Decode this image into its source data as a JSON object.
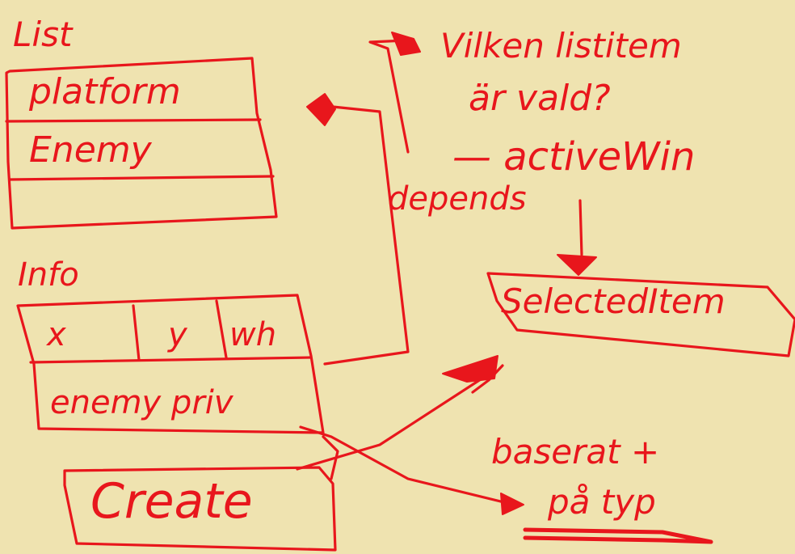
{
  "list": {
    "title": "List",
    "items": [
      "platform",
      "Enemy",
      ""
    ]
  },
  "info": {
    "title": "Info",
    "columns": [
      "x",
      "y",
      "wh"
    ],
    "detail": "enemy priv"
  },
  "create_label": "Create",
  "note": {
    "question_line1": "Vilken listitem",
    "question_line2": "är vald?",
    "active": "— activeWin",
    "depends": "depends"
  },
  "selected_item": "SelectedItem",
  "based_on": {
    "line1": "baserat +",
    "line2": "på typ"
  },
  "colors": {
    "ink": "#e8161c",
    "paper": "#efe3b0"
  }
}
